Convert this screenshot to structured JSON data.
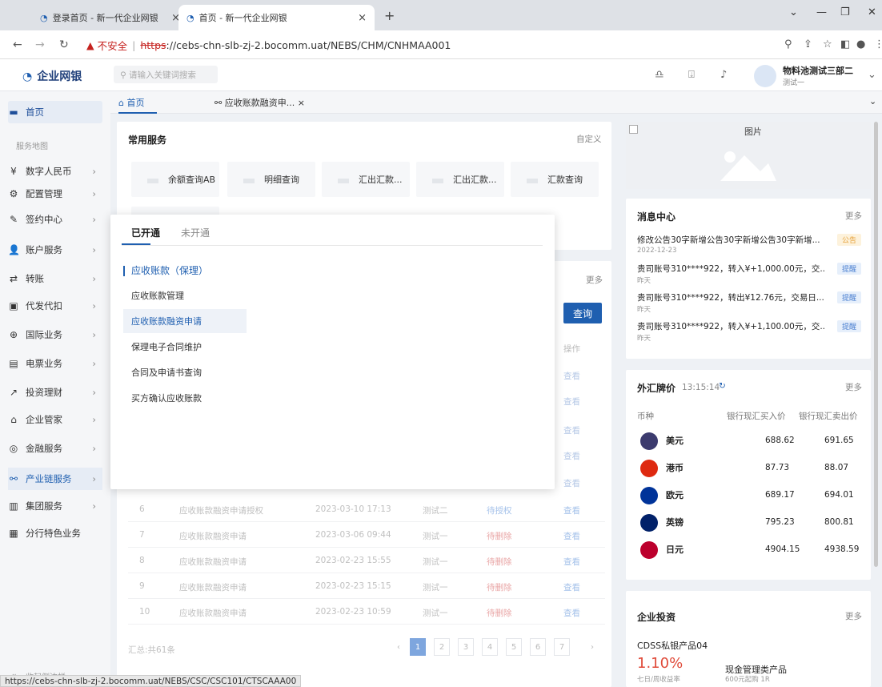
{
  "browser": {
    "tabs": [
      {
        "label": "登录首页 - 新一代企业网银"
      },
      {
        "label": "首页 - 新一代企业网银"
      }
    ],
    "new_tab": "+",
    "address": {
      "warning": "不安全",
      "scheme": "https",
      "rest": "://cebs-chn-slb-zj-2.bocomm.uat/NEBS/CHM/CNHMAA001"
    },
    "status_url": "https://cebs-chn-slb-zj-2.bocomm.uat/NEBS/CSC/CSC101/CTSCAAA00"
  },
  "header": {
    "logo": "企业网银",
    "search_placeholder": "请输入关键词搜索",
    "user_name": "物料池测试三部二",
    "user_sub": "测试一"
  },
  "sidebar": {
    "home": "首页",
    "section_label": "服务地图",
    "items": [
      {
        "label": "数字人民币",
        "icon": "¥"
      },
      {
        "label": "配置管理",
        "icon": "⚙"
      },
      {
        "label": "签约中心",
        "icon": "✎"
      },
      {
        "label": "账户服务",
        "icon": "👤"
      },
      {
        "label": "转账",
        "icon": "⇄"
      },
      {
        "label": "代发代扣",
        "icon": "▣"
      },
      {
        "label": "国际业务",
        "icon": "⊕"
      },
      {
        "label": "电票业务",
        "icon": "▤"
      },
      {
        "label": "投资理财",
        "icon": "↗"
      },
      {
        "label": "企业管家",
        "icon": "⌂"
      },
      {
        "label": "金融服务",
        "icon": "◎"
      },
      {
        "label": "产业链服务",
        "icon": "⚯"
      },
      {
        "label": "集团服务",
        "icon": "▥"
      },
      {
        "label": "分行特色业务",
        "icon": "▦"
      }
    ],
    "collapse": "收起侧边栏"
  },
  "page_tabs": [
    {
      "label": "首页"
    },
    {
      "label": "应收账款融资申..."
    }
  ],
  "common_services": {
    "title": "常用服务",
    "customize": "自定义",
    "items": [
      "余额查询AB",
      "明细查询",
      "汇出汇款...",
      "汇出汇款...",
      "汇款查询"
    ]
  },
  "todo": {
    "more": "更多",
    "query": "查询",
    "op_header": "操作",
    "view": "查看",
    "rows": [
      {
        "no": "6",
        "name": "应收账款融资申请授权",
        "time": "2023-03-10 17:13",
        "user": "测试二",
        "status": "待授权"
      },
      {
        "no": "7",
        "name": "应收账款融资申请",
        "time": "2023-03-06 09:44",
        "user": "测试一",
        "status": "待删除"
      },
      {
        "no": "8",
        "name": "应收账款融资申请",
        "time": "2023-02-23 15:55",
        "user": "测试一",
        "status": "待删除"
      },
      {
        "no": "9",
        "name": "应收账款融资申请",
        "time": "2023-02-23 15:15",
        "user": "测试一",
        "status": "待删除"
      },
      {
        "no": "10",
        "name": "应收账款融资申请",
        "time": "2023-02-23 10:59",
        "user": "测试一",
        "status": "待删除"
      }
    ],
    "total": "汇总:共61条",
    "pages": [
      "1",
      "2",
      "3",
      "4",
      "5",
      "6",
      "7"
    ]
  },
  "popup": {
    "tab_open": "已开通",
    "tab_closed": "未开通",
    "group": "应收账款（保理）",
    "items": [
      "应收账款管理",
      "应收账款融资申请",
      "保理电子合同维护",
      "合同及申请书查询",
      "买方确认应收账款"
    ]
  },
  "image_card": {
    "label": "图片"
  },
  "messages": {
    "title": "消息中心",
    "more": "更多",
    "items": [
      {
        "text": "修改公告30字新增公告30字新增公告30字新增...",
        "date": "2022-12-23",
        "badge": "公告"
      },
      {
        "text": "贵司账号310****922，转入¥+1,000.00元，交...",
        "date": "昨天",
        "badge": "提醒"
      },
      {
        "text": "贵司账号310****922，转出¥12.76元，交易日...",
        "date": "昨天",
        "badge": "提醒"
      },
      {
        "text": "贵司账号310****922，转入¥+1,100.00元，交...",
        "date": "昨天",
        "badge": "提醒"
      }
    ]
  },
  "fx": {
    "title": "外汇牌价",
    "time": "13:15:14",
    "more": "更多",
    "col_currency": "币种",
    "col_buy": "银行现汇买入价",
    "col_sell": "银行现汇卖出价",
    "rows": [
      {
        "name": "美元",
        "buy": "688.62",
        "sell": "691.65",
        "flag": "#3c3b6e"
      },
      {
        "name": "港币",
        "buy": "87.73",
        "sell": "88.07",
        "flag": "#de2910"
      },
      {
        "name": "欧元",
        "buy": "689.17",
        "sell": "694.01",
        "flag": "#003399"
      },
      {
        "name": "英镑",
        "buy": "795.23",
        "sell": "800.81",
        "flag": "#012169"
      },
      {
        "name": "日元",
        "buy": "4904.15",
        "sell": "4938.59",
        "flag": "#bc002d"
      }
    ]
  },
  "invest": {
    "title": "企业投资",
    "more": "更多",
    "product": "CDSS私银产品04",
    "rate": "1.10%",
    "rate_label": "七日/周收益率",
    "type": "现金管理类产品",
    "min": "600元起购 1R"
  }
}
